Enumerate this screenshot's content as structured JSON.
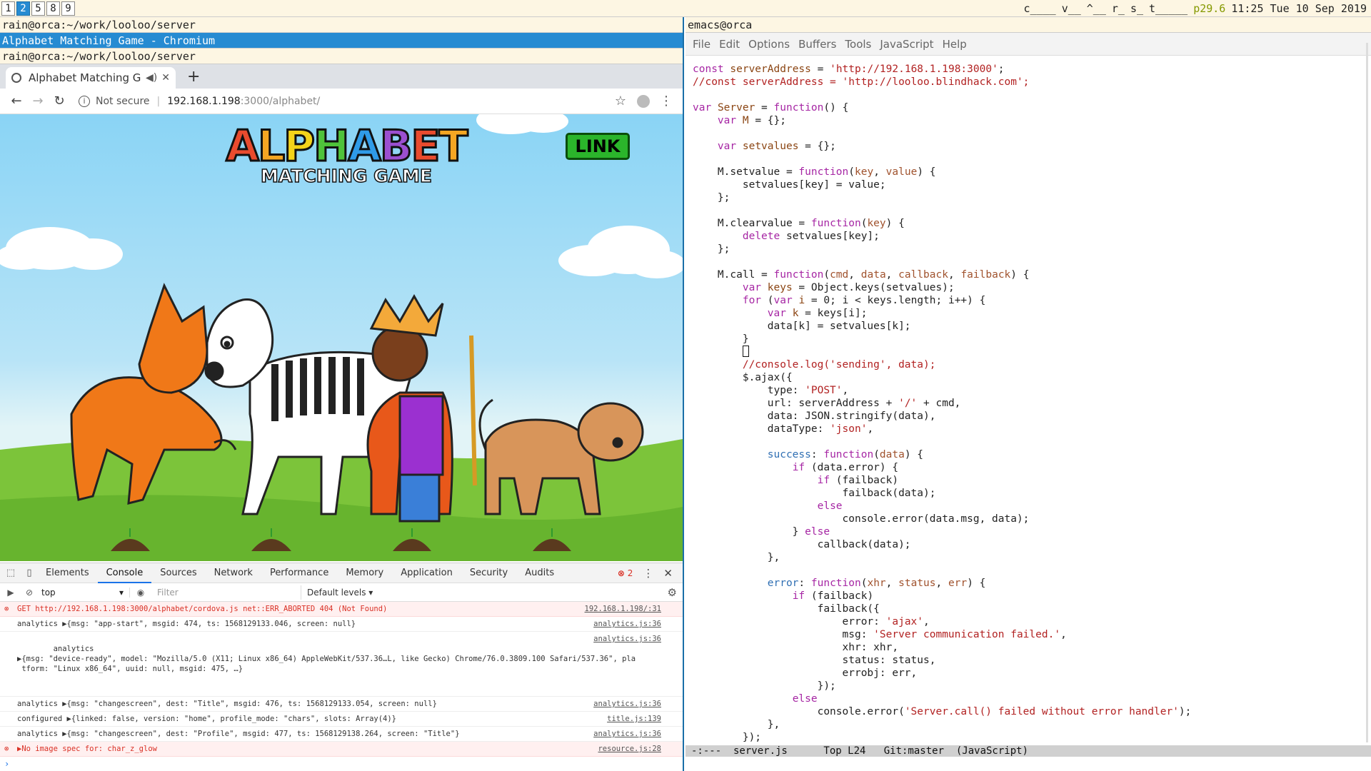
{
  "workspaces": [
    "1",
    "2",
    "5",
    "8",
    "9"
  ],
  "active_workspace": "2",
  "status": {
    "c": "c____",
    "v": "v__",
    "hat": "^__",
    "r": "r_",
    "s": "s_",
    "t": "t_____",
    "p": "p29.6",
    "clock": "11:25 Tue 10 Sep 2019"
  },
  "left": {
    "title1": "rain@orca:~/work/looloo/server",
    "title2": "Alphabet Matching Game - Chromium",
    "title3": "rain@orca:~/work/looloo/server"
  },
  "browser": {
    "tab_title": "Alphabet Matching Ga",
    "security": "Not secure",
    "url_host": "192.168.1.198",
    "url_path": ":3000/alphabet/",
    "new_tab": "+"
  },
  "game": {
    "logo_big": "ALPHABET",
    "logo_small": "MATCHING GAME",
    "link_label": "LINK"
  },
  "devtools": {
    "tabs": [
      "Elements",
      "Console",
      "Sources",
      "Network",
      "Performance",
      "Memory",
      "Application",
      "Security",
      "Audits"
    ],
    "active_tab": "Console",
    "error_count": "2",
    "context": "top",
    "filter_placeholder": "Filter",
    "levels": "Default levels",
    "logs": [
      {
        "type": "error",
        "text": "GET http://192.168.1.198:3000/alphabet/cordova.js net::ERR_ABORTED 404 (Not Found)",
        "src": "192.168.1.198/:31"
      },
      {
        "type": "log",
        "text": "analytics ▶{msg: \"app-start\", msgid: 474, ts: 1568129133.046, screen: null}",
        "src": "analytics.js:36"
      },
      {
        "type": "log",
        "text": "analytics\n▶{msg: \"device-ready\", model: \"Mozilla/5.0 (X11; Linux x86_64) AppleWebKit/537.36…L, like Gecko) Chrome/76.0.3809.100 Safari/537.36\", pla\n tform: \"Linux x86_64\", uuid: null, msgid: 475, …}",
        "src": "analytics.js:36"
      },
      {
        "type": "log",
        "text": "analytics ▶{msg: \"changescreen\", dest: \"Title\", msgid: 476, ts: 1568129133.054, screen: null}",
        "src": "analytics.js:36"
      },
      {
        "type": "log",
        "text": "configured ▶{linked: false, version: \"home\", profile_mode: \"chars\", slots: Array(4)}",
        "src": "title.js:139"
      },
      {
        "type": "log",
        "text": "analytics ▶{msg: \"changescreen\", dest: \"Profile\", msgid: 477, ts: 1568129138.264, screen: \"Title\"}",
        "src": "analytics.js:36"
      },
      {
        "type": "error",
        "text": "▶No image spec for: char_z_glow",
        "src": "resource.js:28"
      }
    ]
  },
  "emacs": {
    "title": "emacs@orca",
    "menu": [
      "File",
      "Edit",
      "Options",
      "Buffers",
      "Tools",
      "JavaScript",
      "Help"
    ],
    "modeline": "-:---  server.js      Top L24   Git:master  (JavaScript)"
  }
}
